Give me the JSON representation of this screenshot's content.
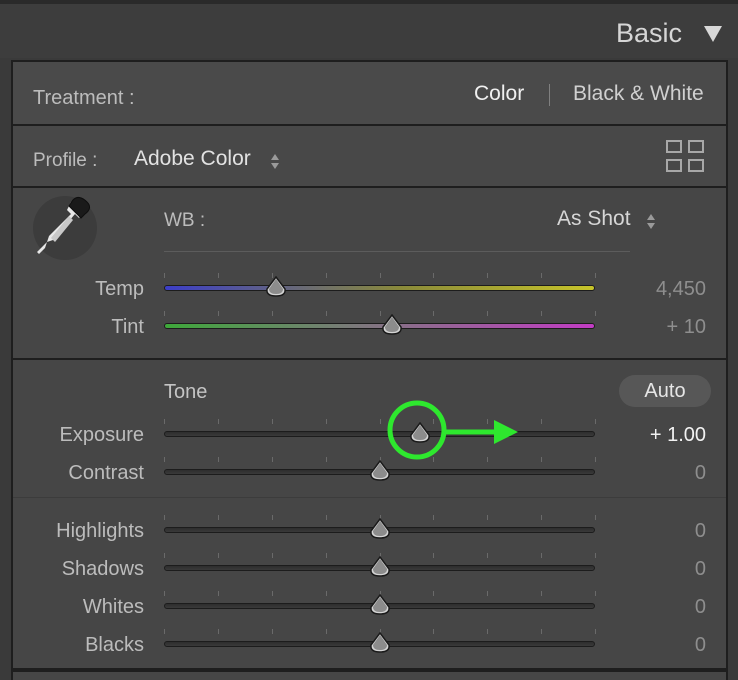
{
  "header": {
    "title": "Basic",
    "collapse_icon": "triangle-down-icon"
  },
  "treatment": {
    "label": "Treatment :",
    "options": [
      "Color",
      "Black & White"
    ],
    "selected": "Color"
  },
  "profile": {
    "label": "Profile :",
    "value": "Adobe Color",
    "browser_icon": "grid-icon"
  },
  "wb": {
    "label": "WB :",
    "value": "As Shot",
    "picker_icon": "eyedropper-icon"
  },
  "sliders": {
    "temp": {
      "label": "Temp",
      "value": "4,450",
      "position": 0.26
    },
    "tint": {
      "label": "Tint",
      "value": "+ 10",
      "position": 0.53
    },
    "exposure": {
      "label": "Exposure",
      "value": "+ 1.00",
      "position": 0.595
    },
    "contrast": {
      "label": "Contrast",
      "value": "0",
      "position": 0.5
    },
    "highlights": {
      "label": "Highlights",
      "value": "0",
      "position": 0.5
    },
    "shadows": {
      "label": "Shadows",
      "value": "0",
      "position": 0.5
    },
    "whites": {
      "label": "Whites",
      "value": "0",
      "position": 0.5
    },
    "blacks": {
      "label": "Blacks",
      "value": "0",
      "position": 0.5
    }
  },
  "tone": {
    "label": "Tone",
    "auto_label": "Auto"
  },
  "annotation": {
    "highlight_color": "#2ee82e",
    "arrow_direction": "right"
  }
}
